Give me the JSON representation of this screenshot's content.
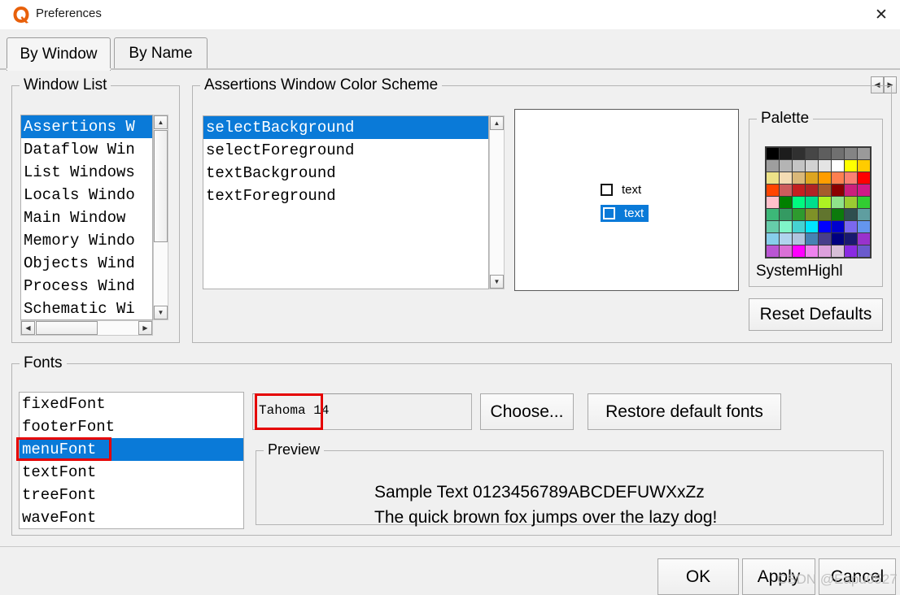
{
  "window": {
    "title": "Preferences",
    "app_icon": "questa-logo-icon",
    "close_label": "✕"
  },
  "tabs": [
    {
      "label": "By Window",
      "active": true
    },
    {
      "label": "By Name",
      "active": false
    }
  ],
  "tab_scrollers": {
    "left": "◀",
    "right": "▶"
  },
  "window_list": {
    "title": "Window List",
    "items": [
      "Assertions W",
      "Dataflow Win",
      "List Windows",
      "Locals Windo",
      "Main Window",
      "Memory Windo",
      "Objects Wind",
      "Process Wind",
      "Schematic Wi"
    ],
    "selected_index": 0,
    "scroll_up": "▲",
    "scroll_down": "▼",
    "scroll_left": "◀",
    "scroll_right": "▶"
  },
  "color_scheme": {
    "title": "Assertions Window Color Scheme",
    "items": [
      "selectBackground",
      "selectForeground",
      "textBackground",
      "textForeground"
    ],
    "selected_index": 0,
    "scroll_up": "▲",
    "scroll_down": "▼",
    "preview": {
      "row1_label": "text",
      "row2_label": "text",
      "selected_bg": "#0a7ad8",
      "selected_fg": "#ffffff"
    }
  },
  "palette": {
    "title": "Palette",
    "selected_color_name": "SystemHighl",
    "colors": [
      [
        "#000000",
        "#1c1c1c",
        "#303030",
        "#464646",
        "#5e5e5e",
        "#707070",
        "#848484",
        "#9a9a9a"
      ],
      [
        "#9e9e9e",
        "#b4b4b4",
        "#c4c4c4",
        "#d2d2d2",
        "#e4e4e4",
        "#ffffff",
        "#ffff00",
        "#ffcc00"
      ],
      [
        "#ece288",
        "#f4dcb4",
        "#dab879",
        "#dda520",
        "#ff9d00",
        "#fd7f50",
        "#fa8072",
        "#ff0000"
      ],
      [
        "#ff4500",
        "#cd5c5c",
        "#c32020",
        "#b02424",
        "#a65c2b",
        "#8b0000",
        "#cc1f7c",
        "#d11a87"
      ],
      [
        "#ffc0cb",
        "#008000",
        "#00fa80",
        "#00e08c",
        "#adf222",
        "#8fe28a",
        "#9bcc32",
        "#32cd32"
      ],
      [
        "#3cb878",
        "#349a62",
        "#2e9a2e",
        "#7f9127",
        "#61752e",
        "#0c7a0c",
        "#2f4f4f",
        "#5f9ea0"
      ],
      [
        "#66cdaa",
        "#7ff5c8",
        "#46d2d2",
        "#00e5ff",
        "#0000ff",
        "#0000cd",
        "#7b68ee",
        "#6495ed"
      ],
      [
        "#87ceeb",
        "#b0d4ee",
        "#b0c4de",
        "#4682b4",
        "#483d8b",
        "#000080",
        "#191970",
        "#9932cc"
      ],
      [
        "#ba55d3",
        "#da70d6",
        "#ff00ff",
        "#ee82ee",
        "#dda0dd",
        "#d8bfd8",
        "#8a2be2",
        "#6a5acd"
      ]
    ]
  },
  "reset_defaults_button": "Reset Defaults",
  "fonts": {
    "title": "Fonts",
    "items": [
      "fixedFont",
      "footerFont",
      "menuFont",
      "textFont",
      "treeFont",
      "waveFont"
    ],
    "selected_index": 2,
    "value": "Tahoma 14",
    "choose_button": "Choose...",
    "restore_button": "Restore default fonts"
  },
  "preview": {
    "title": "Preview",
    "line1": "Sample Text 0123456789ABCDEFUWXxZz",
    "line2": "The quick brown fox jumps over the lazy dog!"
  },
  "footer_buttons": {
    "ok": "OK",
    "apply": "Apply",
    "cancel": "Cancel"
  },
  "watermark": "CSDN @Eapu0527",
  "accent_color": "#0a7ad8",
  "annotation_color": "#e50000"
}
